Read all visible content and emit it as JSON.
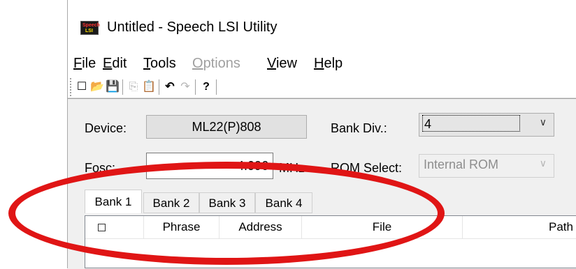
{
  "window": {
    "title": "Untitled - Speech LSI Utility",
    "app_icon_text": [
      "Speech",
      "LSI"
    ]
  },
  "menubar": {
    "items": [
      {
        "label": "File",
        "accel": "F",
        "rest": "ile",
        "enabled": true
      },
      {
        "label": "Edit",
        "accel": "E",
        "rest": "dit",
        "enabled": true
      },
      {
        "label": "Tools",
        "accel": "T",
        "rest": "ools",
        "enabled": true
      },
      {
        "label": "Options",
        "accel": "O",
        "rest": "ptions",
        "enabled": false
      },
      {
        "label": "View",
        "accel": "V",
        "rest": "iew",
        "enabled": true
      },
      {
        "label": "Help",
        "accel": "H",
        "rest": "elp",
        "enabled": true
      }
    ]
  },
  "toolbar": {
    "new_icon": "☐",
    "open_icon": "📂",
    "save_icon": "💾",
    "copy_icon": "⎘",
    "paste_icon": "📋",
    "undo_icon": "↶",
    "redo_icon": "↷",
    "help_icon": "?"
  },
  "form": {
    "device_label": "Device:",
    "device_value": "ML22(P)808",
    "bank_div_label": "Bank Div.:",
    "bank_div_value": "4",
    "fosc_label": "Fosc:",
    "fosc_value": "4.096",
    "fosc_unit": "MHz",
    "rom_select_label": "ROM Select:",
    "rom_select_value": "Internal ROM"
  },
  "tabs": [
    "Bank 1",
    "Bank 2",
    "Bank 3",
    "Bank 4"
  ],
  "list": {
    "columns": [
      "Phrase",
      "Address",
      "File",
      "Path"
    ]
  },
  "colors": {
    "annotation_ellipse": "#e01515"
  }
}
